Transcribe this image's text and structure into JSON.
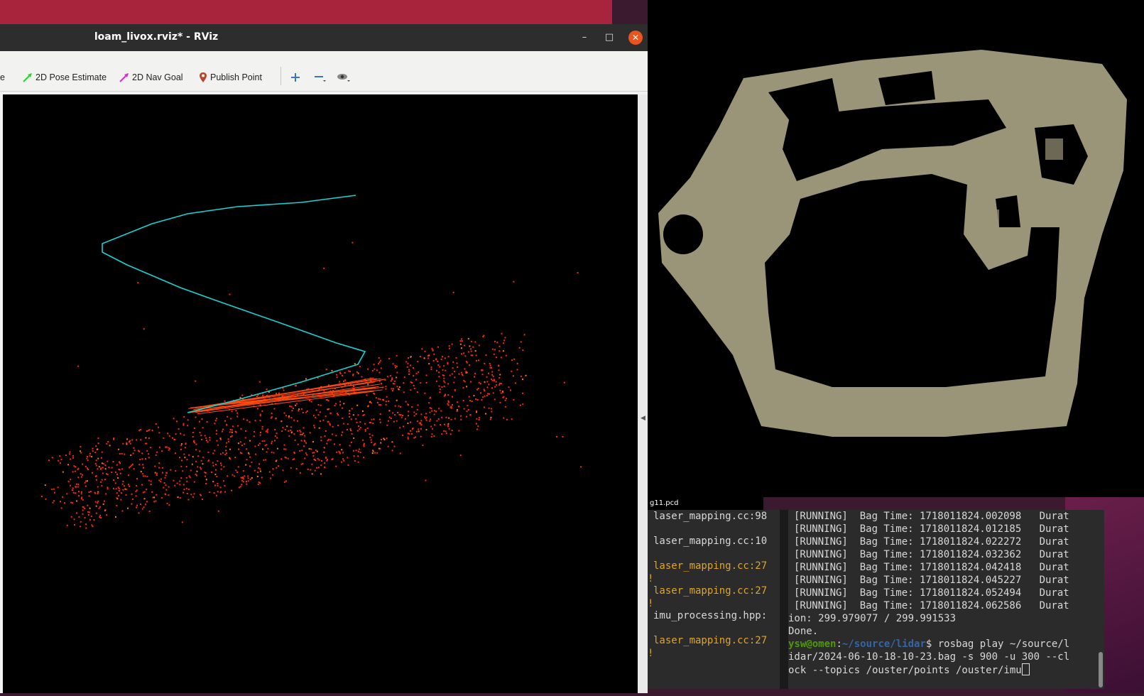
{
  "rviz": {
    "title": "loam_livox.rviz* - RViz",
    "window_buttons": {
      "minimize": "–",
      "maximize": "□",
      "close": "✕"
    },
    "toolbar": {
      "partial_label": "e",
      "pose_estimate": "2D Pose Estimate",
      "nav_goal": "2D Nav Goal",
      "publish_point": "Publish Point"
    }
  },
  "map_viewer": {
    "file_label": "g11.pcd"
  },
  "terminal_left": {
    "lines": [
      "laser_mapping.cc:98",
      "laser_mapping.cc:10",
      "laser_mapping.cc:27",
      "laser_mapping.cc:27",
      "imu_processing.hpp:",
      "laser_mapping.cc:27"
    ],
    "warning_marks": [
      "!",
      "!",
      "!"
    ]
  },
  "terminal_right": {
    "running_lines": [
      "[RUNNING]  Bag Time: 1718011824.002098   Durat",
      "[RUNNING]  Bag Time: 1718011824.012185   Durat",
      "[RUNNING]  Bag Time: 1718011824.022272   Durat",
      "[RUNNING]  Bag Time: 1718011824.032362   Durat",
      "[RUNNING]  Bag Time: 1718011824.042418   Durat",
      "[RUNNING]  Bag Time: 1718011824.045227   Durat",
      "[RUNNING]  Bag Time: 1718011824.052494   Durat",
      "[RUNNING]  Bag Time: 1718011824.062586   Durat"
    ],
    "duration_line": "ion: 299.979077 / 299.991533",
    "done": "Done.",
    "prompt_user": "ysw@omen",
    "prompt_sep": ":",
    "prompt_path": "~/source/lidar",
    "command_1": "$ rosbag play ~/source/l",
    "command_2": "idar/2024-06-10-18-10-23.bag -s 900 -u 300 --cl",
    "command_3": "ock --topics /ouster/points /ouster/imu"
  },
  "colors": {
    "trajectory": "#19d3d3",
    "points": "#ff2a0a",
    "map_fill": "#9a9478",
    "warning": "#e0a526",
    "close_button": "#e95420"
  }
}
